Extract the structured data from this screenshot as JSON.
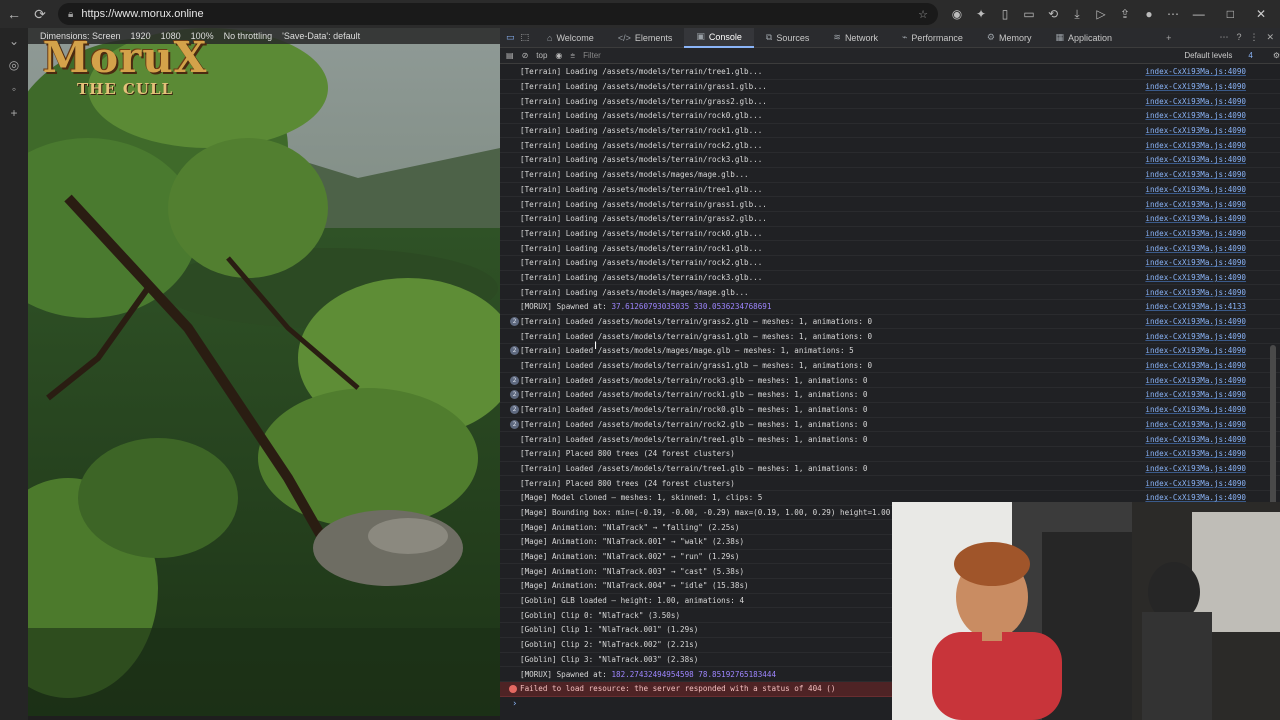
{
  "browser": {
    "url": "https://www.morux.online",
    "nav_icons": [
      "back-icon",
      "refresh-icon"
    ],
    "toolbar_icons": [
      "extension-icon",
      "puzzle-icon",
      "split-icon",
      "tabs-icon",
      "history-icon",
      "download-icon",
      "forward-icon",
      "share-icon",
      "profile-icon",
      "more-icon"
    ],
    "window_controls": [
      "—",
      "□",
      "✕"
    ]
  },
  "device_toolbar": {
    "dimensions": "Dimensions: Screen",
    "width": "1920",
    "height": "1080",
    "zoom": "100%",
    "throttling": "No throttling",
    "save_data": "'Save-Data': default"
  },
  "game": {
    "title": "MoruX",
    "subtitle": "THE CULL"
  },
  "devtools": {
    "tabs": [
      {
        "label": "Welcome",
        "icon": "home-icon",
        "active": false
      },
      {
        "label": "Elements",
        "icon": "code-icon",
        "active": false
      },
      {
        "label": "Console",
        "icon": "console-icon",
        "active": true
      },
      {
        "label": "Sources",
        "icon": "sources-icon",
        "active": false
      },
      {
        "label": "Network",
        "icon": "wifi-icon",
        "active": false
      },
      {
        "label": "Performance",
        "icon": "performance-icon",
        "active": false
      },
      {
        "label": "Memory",
        "icon": "memory-icon",
        "active": false
      },
      {
        "label": "Application",
        "icon": "application-icon",
        "active": false
      }
    ],
    "context": "top",
    "filter_placeholder": "Filter",
    "levels": "Default levels",
    "issues_count": "4",
    "console_rows": [
      {
        "msg": "[Terrain] Loading /assets/models/terrain/tree1.glb...",
        "src": "index-CxXi93Ma.js:4090"
      },
      {
        "msg": "[Terrain] Loading /assets/models/terrain/grass1.glb...",
        "src": "index-CxXi93Ma.js:4090"
      },
      {
        "msg": "[Terrain] Loading /assets/models/terrain/grass2.glb...",
        "src": "index-CxXi93Ma.js:4090"
      },
      {
        "msg": "[Terrain] Loading /assets/models/terrain/rock0.glb...",
        "src": "index-CxXi93Ma.js:4090"
      },
      {
        "msg": "[Terrain] Loading /assets/models/terrain/rock1.glb...",
        "src": "index-CxXi93Ma.js:4090"
      },
      {
        "msg": "[Terrain] Loading /assets/models/terrain/rock2.glb...",
        "src": "index-CxXi93Ma.js:4090"
      },
      {
        "msg": "[Terrain] Loading /assets/models/terrain/rock3.glb...",
        "src": "index-CxXi93Ma.js:4090"
      },
      {
        "msg": "[Terrain] Loading /assets/models/mages/mage.glb...",
        "src": "index-CxXi93Ma.js:4090"
      },
      {
        "msg": "[Terrain] Loading /assets/models/terrain/tree1.glb...",
        "src": "index-CxXi93Ma.js:4090"
      },
      {
        "msg": "[Terrain] Loading /assets/models/terrain/grass1.glb...",
        "src": "index-CxXi93Ma.js:4090"
      },
      {
        "msg": "[Terrain] Loading /assets/models/terrain/grass2.glb...",
        "src": "index-CxXi93Ma.js:4090"
      },
      {
        "msg": "[Terrain] Loading /assets/models/terrain/rock0.glb...",
        "src": "index-CxXi93Ma.js:4090"
      },
      {
        "msg": "[Terrain] Loading /assets/models/terrain/rock1.glb...",
        "src": "index-CxXi93Ma.js:4090"
      },
      {
        "msg": "[Terrain] Loading /assets/models/terrain/rock2.glb...",
        "src": "index-CxXi93Ma.js:4090"
      },
      {
        "msg": "[Terrain] Loading /assets/models/terrain/rock3.glb...",
        "src": "index-CxXi93Ma.js:4090"
      },
      {
        "msg": "[Terrain] Loading /assets/models/mages/mage.glb...",
        "src": "index-CxXi93Ma.js:4090"
      },
      {
        "msg": "[MORUX] Spawned at: ",
        "nums": "37.61260793035035 330.0536234768691",
        "src": "index-CxXi93Ma.js:4133"
      },
      {
        "badge": "2",
        "msg": "[Terrain] Loaded /assets/models/terrain/grass2.glb — meshes: 1, animations: 0",
        "src": "index-CxXi93Ma.js:4090"
      },
      {
        "msg": "[Terrain] Loaded /assets/models/terrain/grass1.glb — meshes: 1, animations: 0",
        "src": "index-CxXi93Ma.js:4090"
      },
      {
        "badge": "2",
        "msg": "[Terrain] Loaded /assets/models/mages/mage.glb — meshes: 1, animations: 5",
        "src": "index-CxXi93Ma.js:4090"
      },
      {
        "msg": "[Terrain] Loaded /assets/models/terrain/grass1.glb — meshes: 1, animations: 0",
        "src": "index-CxXi93Ma.js:4090"
      },
      {
        "badge": "2",
        "msg": "[Terrain] Loaded /assets/models/terrain/rock3.glb — meshes: 1, animations: 0",
        "src": "index-CxXi93Ma.js:4090"
      },
      {
        "badge": "2",
        "msg": "[Terrain] Loaded /assets/models/terrain/rock1.glb — meshes: 1, animations: 0",
        "src": "index-CxXi93Ma.js:4090"
      },
      {
        "badge": "2",
        "msg": "[Terrain] Loaded /assets/models/terrain/rock0.glb — meshes: 1, animations: 0",
        "src": "index-CxXi93Ma.js:4090"
      },
      {
        "badge": "2",
        "msg": "[Terrain] Loaded /assets/models/terrain/rock2.glb — meshes: 1, animations: 0",
        "src": "index-CxXi93Ma.js:4090"
      },
      {
        "msg": "[Terrain] Loaded /assets/models/terrain/tree1.glb — meshes: 1, animations: 0",
        "src": "index-CxXi93Ma.js:4090"
      },
      {
        "msg": "[Terrain] Placed 800 trees (24 forest clusters)",
        "src": "index-CxXi93Ma.js:4090"
      },
      {
        "msg": "[Terrain] Loaded /assets/models/terrain/tree1.glb — meshes: 1, animations: 0",
        "src": "index-CxXi93Ma.js:4090"
      },
      {
        "msg": "[Terrain] Placed 800 trees (24 forest clusters)",
        "src": "index-CxXi93Ma.js:4090"
      },
      {
        "msg": "[Mage] Model cloned — meshes: 1, skinned: 1, clips: 5",
        "src": "index-CxXi93Ma.js:4090"
      },
      {
        "msg": "[Mage] Bounding box: min=(-0.19, -0.00, -0.29) max=(0.19, 1.00, 0.29) height=1.00",
        "src": ""
      },
      {
        "msg": "[Mage] Animation: \"NlaTrack\" → \"falling\" (2.25s)",
        "src": ""
      },
      {
        "msg": "[Mage] Animation: \"NlaTrack.001\" → \"walk\" (2.38s)",
        "src": ""
      },
      {
        "msg": "[Mage] Animation: \"NlaTrack.002\" → \"run\" (1.29s)",
        "src": ""
      },
      {
        "msg": "[Mage] Animation: \"NlaTrack.003\" → \"cast\" (5.38s)",
        "src": ""
      },
      {
        "msg": "[Mage] Animation: \"NlaTrack.004\" → \"idle\" (15.38s)",
        "src": ""
      },
      {
        "msg": "[Goblin] GLB loaded — height: 1.00, animations: 4",
        "src": ""
      },
      {
        "msg": "[Goblin] Clip 0: \"NlaTrack\" (3.50s)",
        "src": ""
      },
      {
        "msg": "[Goblin] Clip 1: \"NlaTrack.001\" (1.29s)",
        "src": ""
      },
      {
        "msg": "[Goblin] Clip 2: \"NlaTrack.002\" (2.21s)",
        "src": ""
      },
      {
        "msg": "[Goblin] Clip 3: \"NlaTrack.003\" (2.38s)",
        "src": ""
      },
      {
        "msg": "[MORUX] Spawned at: ",
        "nums": "182.27432494954598 78.85192765183444",
        "src": ""
      },
      {
        "error": true,
        "msg": "Failed to load resource: the server responded with a status of 404 ()",
        "src": ""
      }
    ],
    "prompt": "›"
  }
}
